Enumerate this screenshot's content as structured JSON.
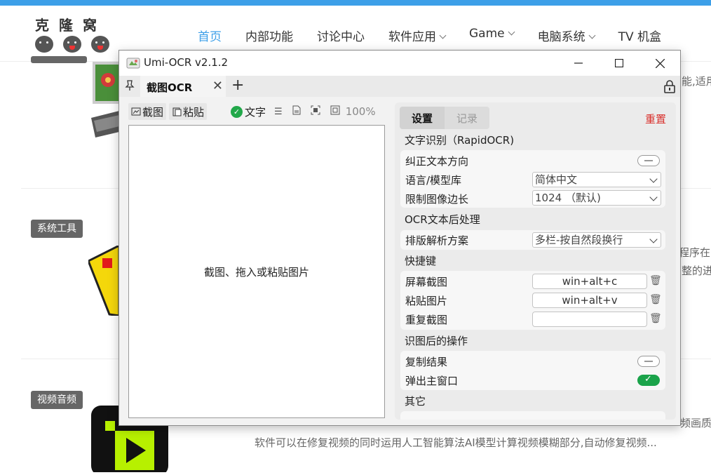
{
  "site": {
    "logo_text": "克隆窝",
    "nav": [
      {
        "label": "首页"
      },
      {
        "label": "内部功能"
      },
      {
        "label": "讨论中心"
      },
      {
        "label": "软件应用"
      },
      {
        "label": "Game"
      },
      {
        "label": "电脑系统"
      },
      {
        "label": "TV 机盒"
      }
    ],
    "categories": [
      {
        "label": "系统工具"
      },
      {
        "label": "视频音频"
      }
    ],
    "snippets": {
      "s1": "能,适用",
      "s2": "程序在",
      "s3": "整的进",
      "s4": "频画质",
      "s5": "软件可以在修复视频的同时运用人工智能算法AI模型计算视频模糊部分,自动修复视频..."
    }
  },
  "window": {
    "title": "Umi-OCR v2.1.2",
    "tab_label": "截图OCR",
    "left_toolbar": {
      "screenshot": "截图",
      "paste": "粘贴",
      "text": "文字",
      "zoom": "100%"
    },
    "canvas_hint": "截图、拖入或粘贴图片",
    "right": {
      "tab_settings": "设置",
      "tab_records": "记录",
      "reset": "重置",
      "sec_ocr": "文字识别（RapidOCR)",
      "correct_direction": "纠正文本方向",
      "language": "语言/模型库",
      "language_value": "简体中文",
      "limit_size": "限制图像边长",
      "limit_size_value": "1024 （默认)",
      "sec_post": "OCR文本后处理",
      "layout": "排版解析方案",
      "layout_value": "多栏-按自然段换行",
      "sec_hotkeys": "快捷键",
      "hk_screenshot": "屏幕截图",
      "hk_screenshot_value": "win+alt+c",
      "hk_paste": "粘贴图片",
      "hk_paste_value": "win+alt+v",
      "hk_repeat": "重复截图",
      "hk_repeat_value": "",
      "sec_after": "识图后的操作",
      "copy_result": "复制结果",
      "popup_main": "弹出主窗口",
      "sec_other": "其它"
    }
  }
}
